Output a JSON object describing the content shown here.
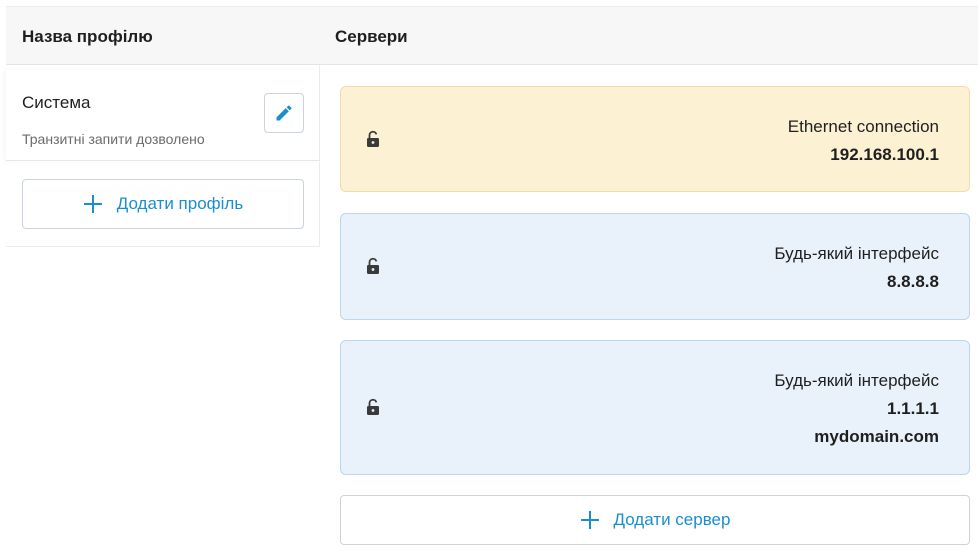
{
  "header": {
    "profile_col": "Назва профілю",
    "servers_col": "Сервери"
  },
  "profile": {
    "name": "Система",
    "description": "Транзитні запити дозволено",
    "edit_icon": "pencil-icon"
  },
  "add_profile": {
    "label": "Додати профіль",
    "icon": "plus-icon"
  },
  "servers": [
    {
      "interface": "Ethernet connection",
      "addresses": [
        "192.168.100.1"
      ],
      "lock_icon": "unlocked-padlock-icon",
      "highlight": true
    },
    {
      "interface": "Будь-який інтерфейс",
      "addresses": [
        "8.8.8.8"
      ],
      "lock_icon": "unlocked-padlock-icon",
      "highlight": false
    },
    {
      "interface": "Будь-який інтерфейс",
      "addresses": [
        "1.1.1.1",
        "mydomain.com"
      ],
      "lock_icon": "unlocked-padlock-icon",
      "highlight": false
    }
  ],
  "add_server": {
    "label": "Додати сервер",
    "icon": "plus-icon"
  },
  "colors": {
    "accent": "#1a8ed0",
    "warning_bg": "#fdf1d3",
    "info_bg": "#e9f2fa"
  }
}
